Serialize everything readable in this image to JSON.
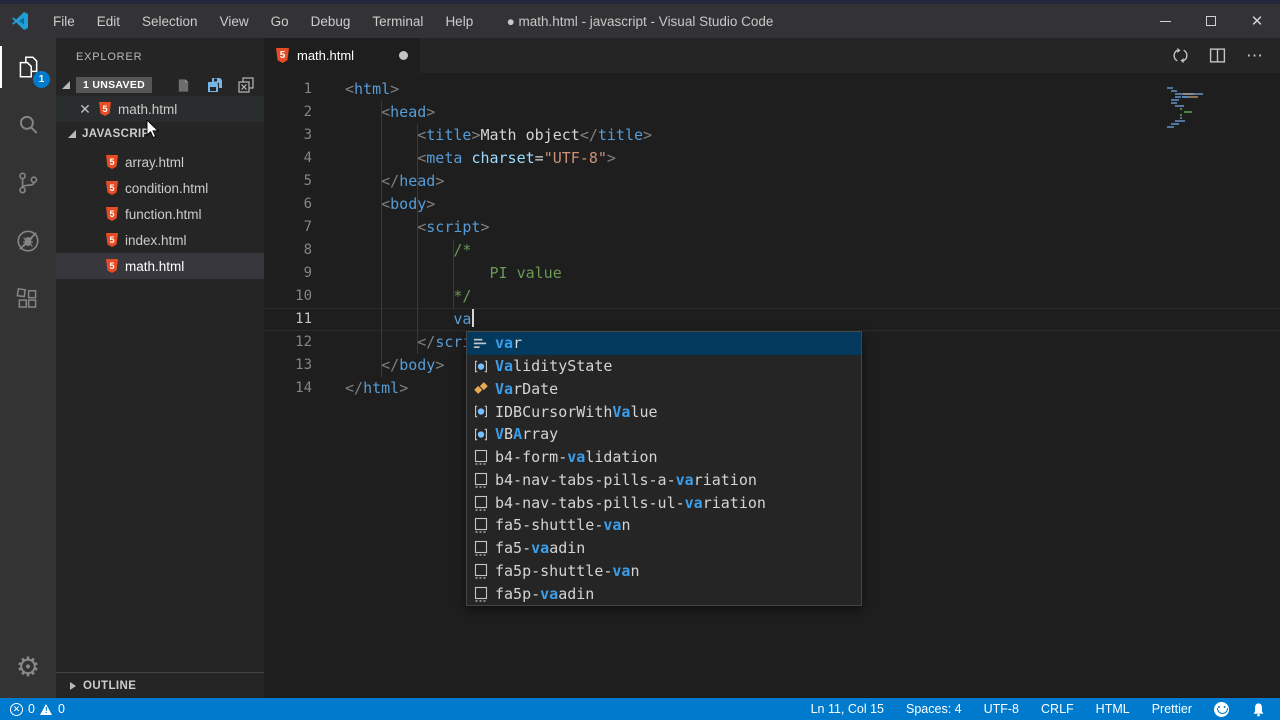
{
  "window": {
    "title": "● math.html - javascript - Visual Studio Code"
  },
  "menubar": {
    "items": [
      "File",
      "Edit",
      "Selection",
      "View",
      "Go",
      "Debug",
      "Terminal",
      "Help"
    ]
  },
  "activity_bar": {
    "items": [
      {
        "icon": "explorer-icon",
        "badge": "1",
        "active": true
      },
      {
        "icon": "search-icon"
      },
      {
        "icon": "source-control-icon"
      },
      {
        "icon": "debug-icon"
      },
      {
        "icon": "extensions-icon"
      }
    ],
    "bottom_icon": "settings-gear-icon"
  },
  "sidebar": {
    "title": "EXPLORER",
    "open_editors": {
      "label": "1 UNSAVED",
      "actions": [
        "new-untitled-file-icon",
        "save-all-icon",
        "close-all-editors-icon"
      ],
      "files": [
        {
          "name": "math.html"
        }
      ]
    },
    "folder": {
      "label": "JAVASCRIPT",
      "files": [
        {
          "name": "array.html"
        },
        {
          "name": "condition.html"
        },
        {
          "name": "function.html"
        },
        {
          "name": "index.html"
        },
        {
          "name": "math.html",
          "selected": true
        }
      ]
    },
    "outline": {
      "label": "OUTLINE"
    }
  },
  "editor": {
    "tab": {
      "name": "math.html",
      "dirty": true
    },
    "actions": [
      "sync-icon",
      "split-editor-icon",
      "more-actions-icon"
    ],
    "cursor": {
      "line": 11,
      "col": 15
    },
    "lines": [
      {
        "n": 1,
        "s": [
          [
            "p",
            "<"
          ],
          [
            "tag",
            "html"
          ],
          [
            "p",
            ">"
          ]
        ]
      },
      {
        "n": 2,
        "s": [
          [
            "ws",
            "    "
          ],
          [
            "p",
            "<"
          ],
          [
            "tag",
            "head"
          ],
          [
            "p",
            ">"
          ]
        ]
      },
      {
        "n": 3,
        "s": [
          [
            "ws",
            "        "
          ],
          [
            "p",
            "<"
          ],
          [
            "tag",
            "title"
          ],
          [
            "p",
            ">"
          ],
          [
            "txt",
            "Math object"
          ],
          [
            "p",
            "</"
          ],
          [
            "tag",
            "title"
          ],
          [
            "p",
            ">"
          ]
        ]
      },
      {
        "n": 4,
        "s": [
          [
            "ws",
            "        "
          ],
          [
            "p",
            "<"
          ],
          [
            "tag",
            "meta"
          ],
          [
            "ws",
            " "
          ],
          [
            "attr",
            "charset"
          ],
          [
            "op",
            "="
          ],
          [
            "str",
            "\"UTF-8\""
          ],
          [
            "p",
            ">"
          ]
        ]
      },
      {
        "n": 5,
        "s": [
          [
            "ws",
            "    "
          ],
          [
            "p",
            "</"
          ],
          [
            "tag",
            "head"
          ],
          [
            "p",
            ">"
          ]
        ]
      },
      {
        "n": 6,
        "s": [
          [
            "ws",
            "    "
          ],
          [
            "p",
            "<"
          ],
          [
            "tag",
            "body"
          ],
          [
            "p",
            ">"
          ]
        ]
      },
      {
        "n": 7,
        "s": [
          [
            "ws",
            "        "
          ],
          [
            "p",
            "<"
          ],
          [
            "tag",
            "script"
          ],
          [
            "p",
            ">"
          ]
        ]
      },
      {
        "n": 8,
        "s": [
          [
            "ws",
            "            "
          ],
          [
            "cmt",
            "/*"
          ]
        ]
      },
      {
        "n": 9,
        "s": [
          [
            "ws",
            "                "
          ],
          [
            "cmt",
            "PI value"
          ]
        ]
      },
      {
        "n": 10,
        "s": [
          [
            "ws",
            "            "
          ],
          [
            "cmt",
            "*/"
          ]
        ]
      },
      {
        "n": 11,
        "s": [
          [
            "ws",
            "            "
          ],
          [
            "kw",
            "va"
          ]
        ],
        "current": true
      },
      {
        "n": 12,
        "s": [
          [
            "ws",
            "        "
          ],
          [
            "p",
            "</"
          ],
          [
            "tag",
            "script"
          ],
          [
            "p",
            ">"
          ]
        ]
      },
      {
        "n": 13,
        "s": [
          [
            "ws",
            "    "
          ],
          [
            "p",
            "</"
          ],
          [
            "tag",
            "body"
          ],
          [
            "p",
            ">"
          ]
        ]
      },
      {
        "n": 14,
        "s": [
          [
            "p",
            "</"
          ],
          [
            "tag",
            "html"
          ],
          [
            "p",
            ">"
          ]
        ]
      }
    ]
  },
  "suggest": {
    "items": [
      {
        "kind": "keyword",
        "selected": true,
        "parts": [
          [
            "va",
            1
          ],
          [
            "r",
            0
          ]
        ]
      },
      {
        "kind": "class",
        "parts": [
          [
            "Va",
            1
          ],
          [
            "lidityState",
            0
          ]
        ]
      },
      {
        "kind": "field",
        "parts": [
          [
            "Va",
            1
          ],
          [
            "rDate",
            0
          ]
        ]
      },
      {
        "kind": "class",
        "parts": [
          [
            "IDBCursorWith",
            0
          ],
          [
            "Va",
            1
          ],
          [
            "lue",
            0
          ]
        ]
      },
      {
        "kind": "class",
        "parts": [
          [
            "V",
            1
          ],
          [
            "B",
            0
          ],
          [
            "A",
            1
          ],
          [
            "rray",
            0
          ]
        ]
      },
      {
        "kind": "snippet",
        "parts": [
          [
            "b4-form-",
            0
          ],
          [
            "va",
            1
          ],
          [
            "lidation",
            0
          ]
        ]
      },
      {
        "kind": "snippet",
        "parts": [
          [
            "b4-nav-tabs-pills-a-",
            0
          ],
          [
            "va",
            1
          ],
          [
            "riation",
            0
          ]
        ]
      },
      {
        "kind": "snippet",
        "parts": [
          [
            "b4-nav-tabs-pills-ul-",
            0
          ],
          [
            "va",
            1
          ],
          [
            "riation",
            0
          ]
        ]
      },
      {
        "kind": "snippet",
        "parts": [
          [
            "fa5-shuttle-",
            0
          ],
          [
            "va",
            1
          ],
          [
            "n",
            0
          ]
        ]
      },
      {
        "kind": "snippet",
        "parts": [
          [
            "fa5-",
            0
          ],
          [
            "va",
            1
          ],
          [
            "adin",
            0
          ]
        ]
      },
      {
        "kind": "snippet",
        "parts": [
          [
            "fa5p-shuttle-",
            0
          ],
          [
            "va",
            1
          ],
          [
            "n",
            0
          ]
        ]
      },
      {
        "kind": "snippet",
        "parts": [
          [
            "fa5p-",
            0
          ],
          [
            "va",
            1
          ],
          [
            "adin",
            0
          ]
        ]
      }
    ]
  },
  "status_bar": {
    "errors": "0",
    "warnings": "0",
    "right": [
      "Ln 11, Col 15",
      "Spaces: 4",
      "UTF-8",
      "CRLF",
      "HTML",
      "Prettier"
    ],
    "right_icons": [
      "feedback-smiley-icon",
      "notifications-bell-icon"
    ]
  },
  "colors": {
    "accent": "#007acc",
    "titlebar": "#333336",
    "sidebar": "#252526",
    "editor": "#1e1e1e",
    "tag": "#569cd6",
    "attribute": "#9cdcfe",
    "string": "#ce9178",
    "comment": "#6a9955",
    "suggest_highlight": "#3b9eea",
    "suggest_selected_row": "#04395e",
    "html_file_icon": "#e44d26",
    "badge": "#007acc"
  }
}
